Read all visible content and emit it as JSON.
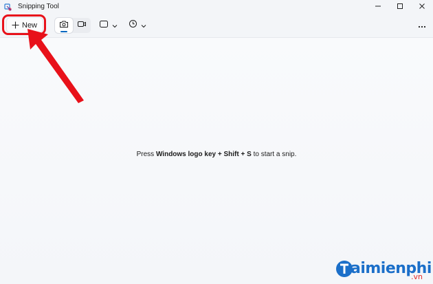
{
  "window": {
    "title": "Snipping Tool",
    "icons": {
      "app": "snipping-tool-app-icon",
      "minimize": "minimize-icon",
      "maximize": "maximize-icon",
      "close": "close-icon"
    }
  },
  "toolbar": {
    "new_label": "New",
    "new_icon": "plus-icon",
    "modes": [
      {
        "icon": "camera-icon",
        "active": true
      },
      {
        "icon": "video-camera-icon",
        "active": false
      }
    ],
    "snip_shape_icon": "rectangle-icon",
    "delay_icon": "clock-icon",
    "more_icon": "more-dots-icon"
  },
  "canvas": {
    "hint_prefix": "Press ",
    "hint_key1": "Windows logo key",
    "hint_plus1": " + ",
    "hint_key2": "Shift",
    "hint_plus2": " + ",
    "hint_key3": "S",
    "hint_suffix": " to start a snip."
  },
  "annotation": {
    "color": "#e8111a"
  },
  "watermark": {
    "text": "aimienphi",
    "suffix": ".vn",
    "color": "#1b6fc9"
  },
  "colors": {
    "accent": "#0067c0"
  }
}
